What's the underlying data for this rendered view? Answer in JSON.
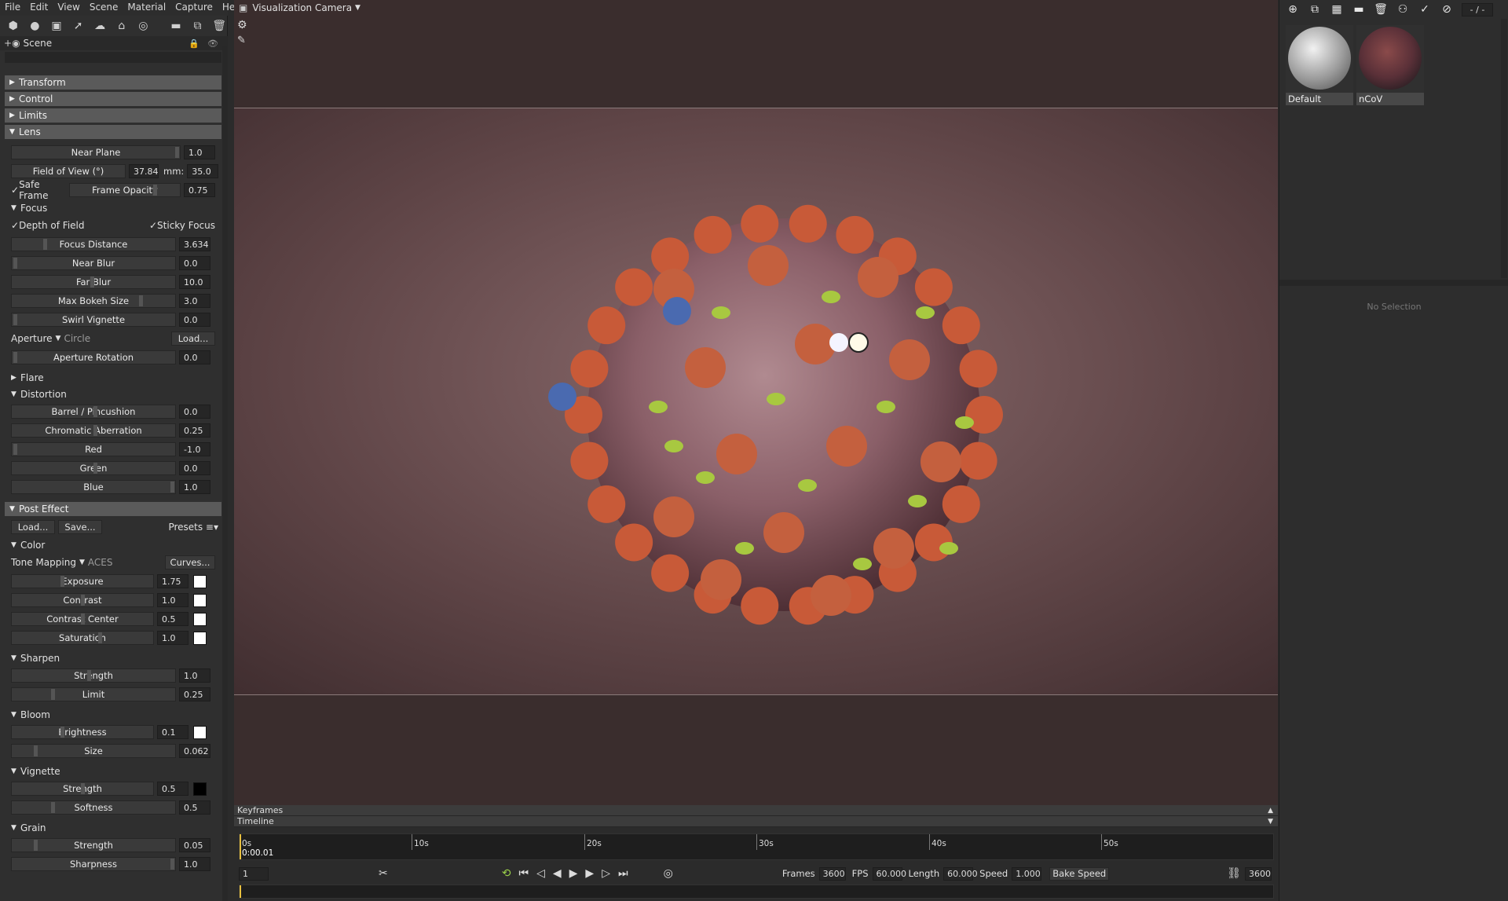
{
  "menu": [
    "File",
    "Edit",
    "View",
    "Scene",
    "Material",
    "Capture",
    "Help"
  ],
  "scene_label": "Scene",
  "sections": {
    "transform": "Transform",
    "control": "Control",
    "limits": "Limits",
    "lens": "Lens",
    "flare": "Flare",
    "distortion": "Distortion",
    "post_effect": "Post Effect"
  },
  "lens": {
    "near_plane_label": "Near Plane",
    "near_plane": "1.0",
    "fov_label": "Field of View (°)",
    "fov": "37.84",
    "mm_label": "mm:",
    "mm": "35.0",
    "safe_frame": "Safe Frame",
    "frame_opacity_label": "Frame Opacity",
    "frame_opacity": "0.75"
  },
  "focus": {
    "title": "Focus",
    "dof": "Depth of Field",
    "sticky": "Sticky Focus",
    "focus_distance_label": "Focus Distance",
    "focus_distance": "3.634",
    "near_blur_label": "Near Blur",
    "near_blur": "0.0",
    "far_blur_label": "Far Blur",
    "far_blur": "10.0",
    "max_bokeh_label": "Max Bokeh Size",
    "max_bokeh": "3.0",
    "swirl_label": "Swirl Vignette",
    "swirl": "0.0",
    "aperture_label": "Aperture",
    "aperture_value": "Circle",
    "load": "Load...",
    "aperture_rot_label": "Aperture Rotation",
    "aperture_rot": "0.0"
  },
  "distortion": {
    "barrel_label": "Barrel / Pincushion",
    "barrel": "0.0",
    "chroma_label": "Chromatic Aberration",
    "chroma": "0.25",
    "red_label": "Red",
    "red": "-1.0",
    "green_label": "Green",
    "green": "0.0",
    "blue_label": "Blue",
    "blue": "1.0"
  },
  "post": {
    "load": "Load...",
    "save": "Save...",
    "presets": "Presets ≡▾",
    "color_title": "Color",
    "tone_label": "Tone Mapping",
    "tone_value": "ACES",
    "curves": "Curves...",
    "exposure_label": "Exposure",
    "exposure": "1.75",
    "contrast_label": "Contrast",
    "contrast": "1.0",
    "contrast_center_label": "Contrast Center",
    "contrast_center": "0.5",
    "saturation_label": "Saturation",
    "saturation": "1.0",
    "sharpen_title": "Sharpen",
    "sh_strength_label": "Strength",
    "sh_strength": "1.0",
    "sh_limit_label": "Limit",
    "sh_limit": "0.25",
    "bloom_title": "Bloom",
    "bl_brightness_label": "Brightness",
    "bl_brightness": "0.1",
    "bl_size_label": "Size",
    "bl_size": "0.062",
    "vignette_title": "Vignette",
    "vg_strength_label": "Strength",
    "vg_strength": "0.5",
    "vg_softness_label": "Softness",
    "vg_softness": "0.5",
    "grain_title": "Grain",
    "gr_strength_label": "Strength",
    "gr_strength": "0.05",
    "gr_sharpness_label": "Sharpness",
    "gr_sharpness": "1.0"
  },
  "viewport": {
    "camera": "Visualization Camera"
  },
  "timeline": {
    "keyframes": "Keyframes",
    "timeline": "Timeline",
    "ticks": [
      "0s",
      "10s",
      "20s",
      "30s",
      "40s",
      "50s"
    ],
    "current_time": "0:00.01",
    "frame": "1",
    "frames_label": "Frames",
    "frames": "3600",
    "fps_label": "FPS",
    "fps": "60.000",
    "length_label": "Length",
    "length": "60.000",
    "speed_label": "Speed",
    "speed": "1.000",
    "bake_speed": "Bake Speed",
    "end_frame": "3600"
  },
  "right": {
    "page": "- / -",
    "materials": [
      "Default",
      "nCoV"
    ],
    "no_selection": "No Selection"
  },
  "colors": {
    "viewport_bg": "#5e4446",
    "section_bg": "#5a5a5a"
  }
}
